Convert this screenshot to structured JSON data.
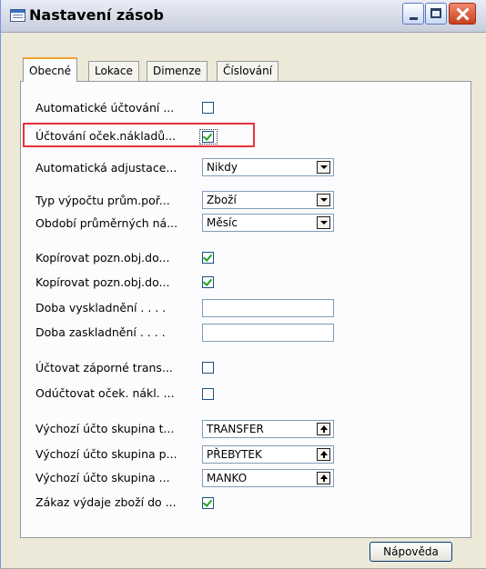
{
  "window": {
    "title": "Nastavení zásob"
  },
  "tabs": [
    {
      "label": "Obecné",
      "active": true
    },
    {
      "label": "Lokace"
    },
    {
      "label": "Dimenze"
    },
    {
      "label": "Číslování"
    }
  ],
  "rows": [
    {
      "label": "Automatické účtování ...",
      "type": "checkbox",
      "checked": false
    },
    {
      "label": "Účtování oček.nákladů...",
      "type": "checkbox",
      "checked": true
    },
    {
      "label": "Automatická adjustace...",
      "type": "select",
      "value": "Nikdy"
    },
    {
      "label": "Typ výpočtu prům.poř...",
      "type": "select",
      "value": "Zboží"
    },
    {
      "label": "Období průměrných ná...",
      "type": "select",
      "value": "Měsíc"
    },
    {
      "label": "Kopírovat pozn.obj.do...",
      "type": "checkbox",
      "checked": true
    },
    {
      "label": "Kopírovat pozn.obj.do...",
      "type": "checkbox",
      "checked": true
    },
    {
      "label": "Doba vyskladnění . . . .",
      "type": "text",
      "value": ""
    },
    {
      "label": "Doba zaskladnění . . . .",
      "type": "text",
      "value": ""
    },
    {
      "label": "Účtovat záporné trans...",
      "type": "checkbox",
      "checked": false
    },
    {
      "label": "Odúčtovat oček. nákl. ...",
      "type": "checkbox",
      "checked": false
    },
    {
      "label": "Výchozí účto skupina t...",
      "type": "lookup",
      "value": "TRANSFER"
    },
    {
      "label": "Výchozí účto skupina p...",
      "type": "lookup",
      "value": "PŘEBYTEK"
    },
    {
      "label": "Výchozí účto skupina ...",
      "type": "lookup",
      "value": "MANKO"
    },
    {
      "label": "Zákaz výdaje zboží do ...",
      "type": "checkbox",
      "checked": true
    }
  ],
  "buttons": {
    "help": "Nápověda"
  },
  "colors": {
    "highlight": "#e8323a",
    "checkmark": "#21a121",
    "tab_accent": "#f1a22b"
  }
}
